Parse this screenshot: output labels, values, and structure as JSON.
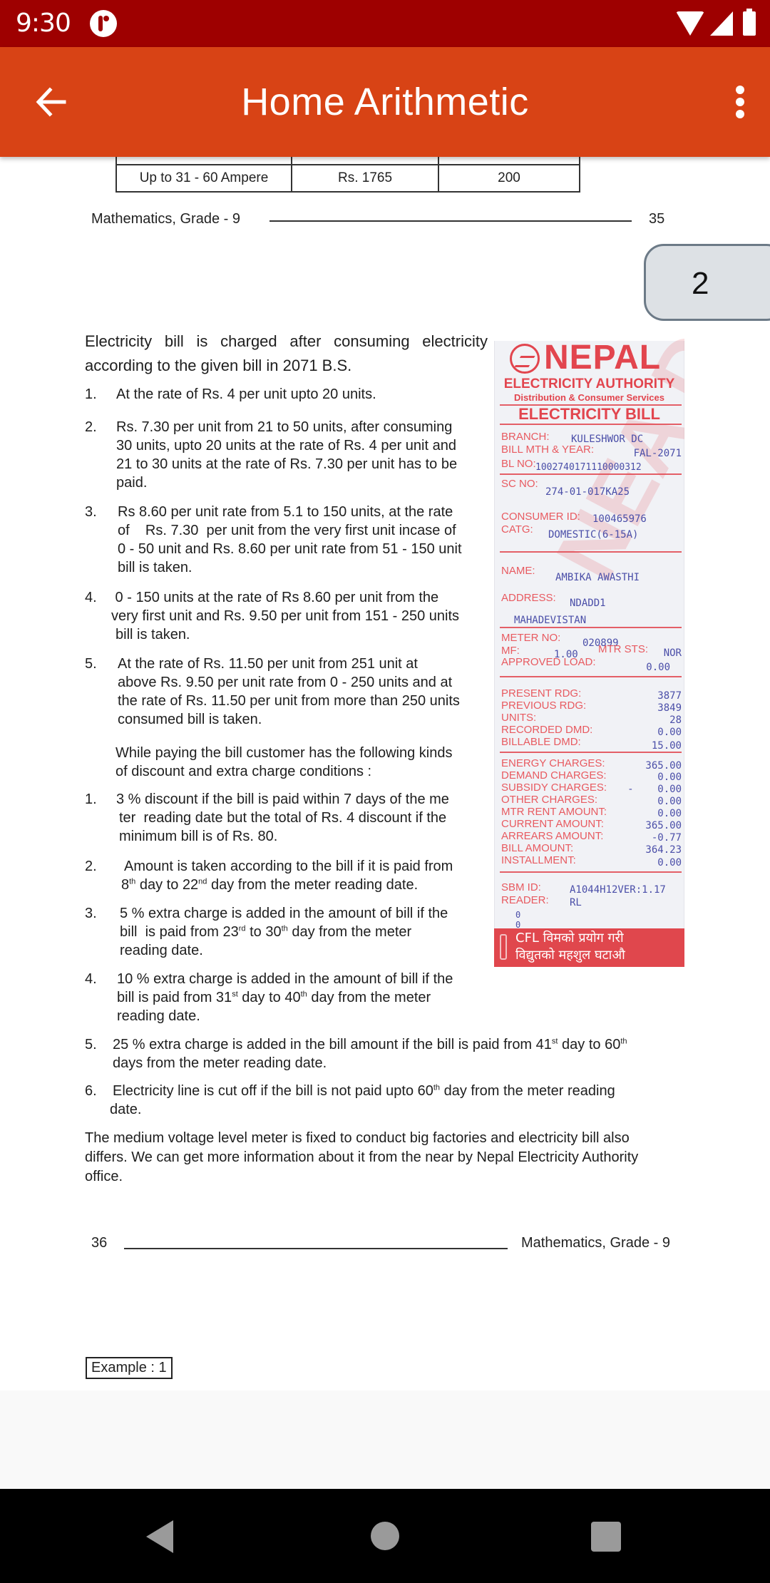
{
  "status_bar": {
    "time": "9:30",
    "icons": [
      "app-notification-icon",
      "wifi-icon",
      "cell-signal-icon",
      "battery-icon"
    ]
  },
  "app_bar": {
    "title": "Home Arithmetic",
    "back_icon": "arrow-back-icon",
    "menu_icon": "more-vert-icon"
  },
  "page_indicator": "2",
  "document": {
    "tariff_table_fragment": {
      "rows": [
        [
          "",
          "",
          ""
        ],
        [
          "Up to 31 - 60 Ampere",
          "Rs. 1765",
          "200"
        ]
      ]
    },
    "footer_page_35": {
      "left": "Mathematics, Grade - 9",
      "right": "35"
    },
    "intro": "Electricity bill is charged after consuming electricity according to the given bill in 2071 B.S.",
    "rates": [
      {
        "num": "1.",
        "text": "At the rate of Rs. 4 per unit upto 20 units."
      },
      {
        "num": "2.",
        "lines": [
          "Rs. 7.30 per unit from 21 to 50 units, after consuming",
          "30 units, upto 20 units at the rate of Rs. 4 per unit and",
          "21 to 30 units at the rate of Rs. 7.30 per unit has to be",
          "paid."
        ]
      },
      {
        "num": "3.",
        "lines": [
          "Rs 8.60 per unit rate from 5.1 to 150 units, at the rate",
          "of    Rs. 7.30  per unit from the very first unit incase of",
          "0 - 50 unit and Rs. 8.60 per unit rate from 51 - 150 unit",
          "bill is taken."
        ]
      },
      {
        "num": "4.",
        "lines": [
          " 0 - 150 units at the rate of Rs 8.60 per unit from the",
          "very first unit and Rs. 9.50 per unit from 151 - 250 units",
          "bill is taken."
        ]
      },
      {
        "num": "5.",
        "lines": [
          "At the rate of Rs. 11.50  per unit from 251 unit at",
          "above Rs. 9.50 per unit rate from 0 - 250 units and at",
          "the rate of Rs. 11.50 per unit from more than 250 units",
          "consumed bill is taken."
        ]
      }
    ],
    "conditions_intro": [
      "While paying the bill customer has the following kinds",
      "of discount and extra charge conditions :"
    ],
    "conditions": [
      {
        "num": "1.",
        "lines": [
          "3 % discount if the bill is paid within 7 days of the me",
          "ter  reading date but the total of Rs. 4 discount if the",
          "minimum bill is of Rs. 80."
        ]
      },
      {
        "num": "2.",
        "line1_a": "Amount is taken according to the bill if it is paid from",
        "line2_a": "8",
        "line2_sup1": "th",
        "line2_b": " day to 22",
        "line2_sup2": "nd",
        "line2_c": " day from the meter reading date."
      },
      {
        "num": "3.",
        "line1": "5 % extra charge is added in the amount of bill if the",
        "line2_a": "bill  is paid from 23",
        "line2_sup1": "rd",
        "line2_b": " to 30",
        "line2_sup2": "th",
        "line2_c": " day from the meter",
        "line3": "reading date."
      },
      {
        "num": "4.",
        "line1": "10 % extra charge is added in the amount of bill if the",
        "line2_a": "bill is paid from 31",
        "line2_sup1": "st",
        "line2_b": " day to 40",
        "line2_sup2": "th",
        "line2_c": " day from the meter",
        "line3": "reading date."
      },
      {
        "num": "5.",
        "line1_a": "25 % extra charge is added in the bill amount if the bill is paid from 41",
        "line1_sup1": "st",
        "line1_b": " day to 60",
        "line1_sup2": "th",
        "line2": "days from the meter reading date."
      },
      {
        "num": "6.",
        "line1_a": "Electricity line is cut off if the bill is not paid upto 60",
        "line1_sup1": "th",
        "line1_b": " day from the meter reading",
        "line2": "date."
      }
    ],
    "closing": [
      "The medium voltage level meter is fixed to conduct big factories and electricity bill also",
      "differs. We can get more information about it from the near by Nepal Electricity Authority",
      "office."
    ],
    "footer_page_36": {
      "left": "36",
      "right": "Mathematics, Grade - 9"
    },
    "example_label": "Example : 1"
  },
  "bill": {
    "brand": "NEPAL",
    "authority": "ELECTRICITY AUTHORITY",
    "services": "Distribution & Consumer Services",
    "heading": "ELECTRICITY BILL",
    "watermark": "NEA DC",
    "fields": {
      "branch": {
        "label": "BRANCH:",
        "value": "KULESHWOR DC"
      },
      "bill_month_year": {
        "label": "BILL MTH & YEAR:",
        "value": "FAL-2071"
      },
      "bl_no": {
        "label": "BL NO:",
        "value": "1002740171110000312"
      },
      "sc_no": {
        "label": "SC NO:",
        "value": "274-01-017KA25"
      },
      "consumer_id": {
        "label": "CONSUMER ID:",
        "value": "100465976"
      },
      "catg": {
        "label": "CATG:",
        "value": "DOMESTIC(6-15A)"
      },
      "name": {
        "label": "NAME:",
        "value": "AMBIKA AWASTHI"
      },
      "address": {
        "label": "ADDRESS:",
        "value": "NDADD1",
        "value2": "MAHADEVISTAN"
      },
      "meter_no": {
        "label": "METER NO:",
        "value": "020899"
      },
      "mf": {
        "label": "MF:",
        "value": "1.00"
      },
      "mtr_sts": {
        "label": "MTR STS:",
        "value": "NOR"
      },
      "approved_load": {
        "label": "APPROVED LOAD:",
        "value": "0.00"
      },
      "present_rdg": {
        "label": "PRESENT RDG:",
        "value": "3877"
      },
      "previous_rdg": {
        "label": "PREVIOUS RDG:",
        "value": "3849"
      },
      "units": {
        "label": "UNITS:",
        "value": "28"
      },
      "recorded_dmd": {
        "label": "RECORDED DMD:",
        "value": "0.00"
      },
      "billable_dmd": {
        "label": "BILLABLE DMD:",
        "value": "15.00"
      },
      "energy_charges": {
        "label": "ENERGY CHARGES:",
        "value": "365.00"
      },
      "demand_charges": {
        "label": "DEMAND CHARGES:",
        "value": "0.00"
      },
      "subsidy_charges": {
        "label": "SUBSIDY CHARGES:",
        "value": "-    0.00"
      },
      "other_charges": {
        "label": "OTHER CHARGES:",
        "value": "0.00"
      },
      "mtr_rent": {
        "label": "MTR RENT AMOUNT:",
        "value": "0.00"
      },
      "current_amount": {
        "label": "CURRENT AMOUNT:",
        "value": "365.00"
      },
      "arrears_amount": {
        "label": "ARREARS AMOUNT:",
        "value": "-0.77"
      },
      "bill_amount": {
        "label": "BILL AMOUNT:",
        "value": "364.23"
      },
      "installment": {
        "label": "INSTALLMENT:",
        "value": "0.00"
      },
      "sbm_id": {
        "label": "SBM ID:",
        "value": "A1044H12VER:1.17"
      },
      "reader": {
        "label": "READER:",
        "value": "RL"
      }
    },
    "footer_zeros": [
      "0",
      "0"
    ],
    "cfl_banner": [
      "CFL विमको प्रयोग गरी",
      "विद्युतको महशुल घटाऔ"
    ],
    "colors": {
      "label_red": "#e2454e",
      "value_blue": "#4a4ea8"
    }
  },
  "nav_bar": {
    "buttons": [
      "nav-back",
      "nav-home",
      "nav-recents"
    ]
  },
  "colors": {
    "status_bar": "#9e0000",
    "app_bar": "#d84315",
    "badge_bg": "#dde1e5",
    "badge_border": "#6c7a87"
  }
}
